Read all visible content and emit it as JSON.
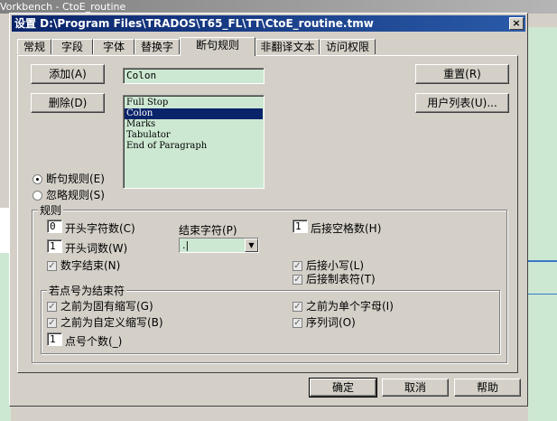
{
  "background": {
    "window_title": "Vorkbench - CtoE_routine"
  },
  "dialog": {
    "title": "设置 D:\\Program Files\\TRADOS\\T65_FL\\TT\\CtoE_routine.tmw",
    "close_label": "×",
    "tabs": [
      {
        "label": "常规"
      },
      {
        "label": "字段"
      },
      {
        "label": "字体"
      },
      {
        "label": "替换字"
      },
      {
        "label": "断句规则",
        "active": true
      },
      {
        "label": "非翻译文本"
      },
      {
        "label": "访问权限"
      }
    ],
    "add_label": "添加(A)",
    "delete_label": "删除(D)",
    "reset_label": "重置(R)",
    "user_list_label": "用户列表(U)...",
    "rule_name_value": "Colon",
    "rule_list": [
      {
        "label": "Full Stop"
      },
      {
        "label": "Colon",
        "selected": true
      },
      {
        "label": "Marks"
      },
      {
        "label": "Tabulator"
      },
      {
        "label": "End of Paragraph"
      }
    ],
    "radio_segment": "断句规则(E)",
    "radio_ignore": "忽略规则(S)",
    "rules_group": {
      "label": "规则",
      "lead_chars_value": "0",
      "lead_chars_label": "开头字符数(C)",
      "end_char_label": "结束字符(P)",
      "end_char_value": ".|",
      "trailing_spaces_value": "1",
      "trailing_spaces_label": "后接空格数(H)",
      "lead_words_value": "1",
      "lead_words_label": "开头词数(W)",
      "numeric_end_label": "数字结束(N)",
      "followed_lower_label": "后接小写(L)",
      "followed_tab_label": "后接制表符(T)"
    },
    "period_group": {
      "label": "若点号为结束符",
      "proper_abbr_label": "之前为固有缩写(G)",
      "single_letter_label": "之前为单个字母(I)",
      "custom_abbr_label": "之前为自定义缩写(B)",
      "ordinal_label": "序列词(O)",
      "dot_count_value": "1",
      "dot_count_label": "点号个数(_)"
    },
    "ok_label": "确定",
    "cancel_label": "取消",
    "help_label": "帮助"
  }
}
